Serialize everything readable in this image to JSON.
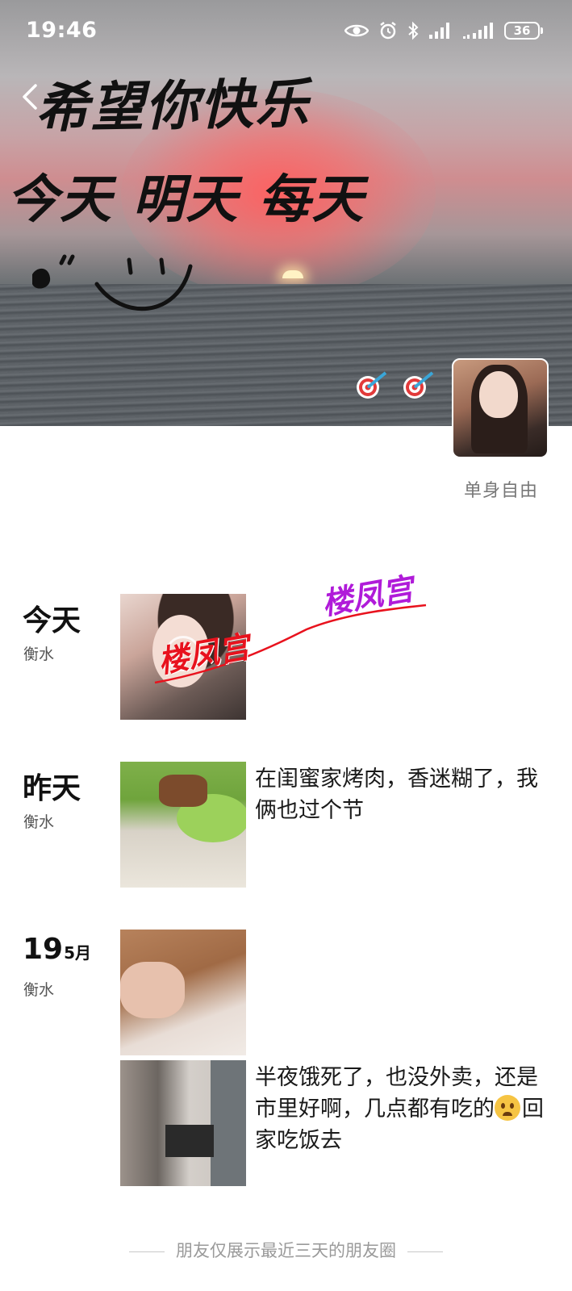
{
  "status_bar": {
    "time": "19:46",
    "battery": "36",
    "icons": [
      "eye-icon",
      "alarm-icon",
      "bluetooth-icon",
      "signal-icon",
      "signal-icon",
      "battery-icon"
    ]
  },
  "cover": {
    "line1": "希望你快乐",
    "line2": "今天 明天 每天"
  },
  "profile": {
    "signature": "单身自由"
  },
  "watermark": {
    "text": "楼凤宫",
    "colors": [
      "#e8121d",
      "#b01bd9"
    ]
  },
  "feed": [
    {
      "date": "今天",
      "month": "",
      "location": "衡水",
      "posts": [
        {
          "image": "selfie-video",
          "text": ""
        }
      ]
    },
    {
      "date": "昨天",
      "month": "",
      "location": "衡水",
      "posts": [
        {
          "image": "lettuce-bbq-photo",
          "text": "在闺蜜家烤肉，香迷糊了，我俩也过个节"
        }
      ]
    },
    {
      "date": "19",
      "month": "5月",
      "location": "衡水",
      "posts": [
        {
          "image": "dog-photo",
          "text": ""
        },
        {
          "image": "hotel-room-photo",
          "text": "半夜饿死了，也没外卖，还是市里好啊，几点都有吃的",
          "text_tail": "回家吃饭去"
        }
      ]
    }
  ],
  "footer": {
    "note": "朋友仅展示最近三天的朋友圈"
  }
}
